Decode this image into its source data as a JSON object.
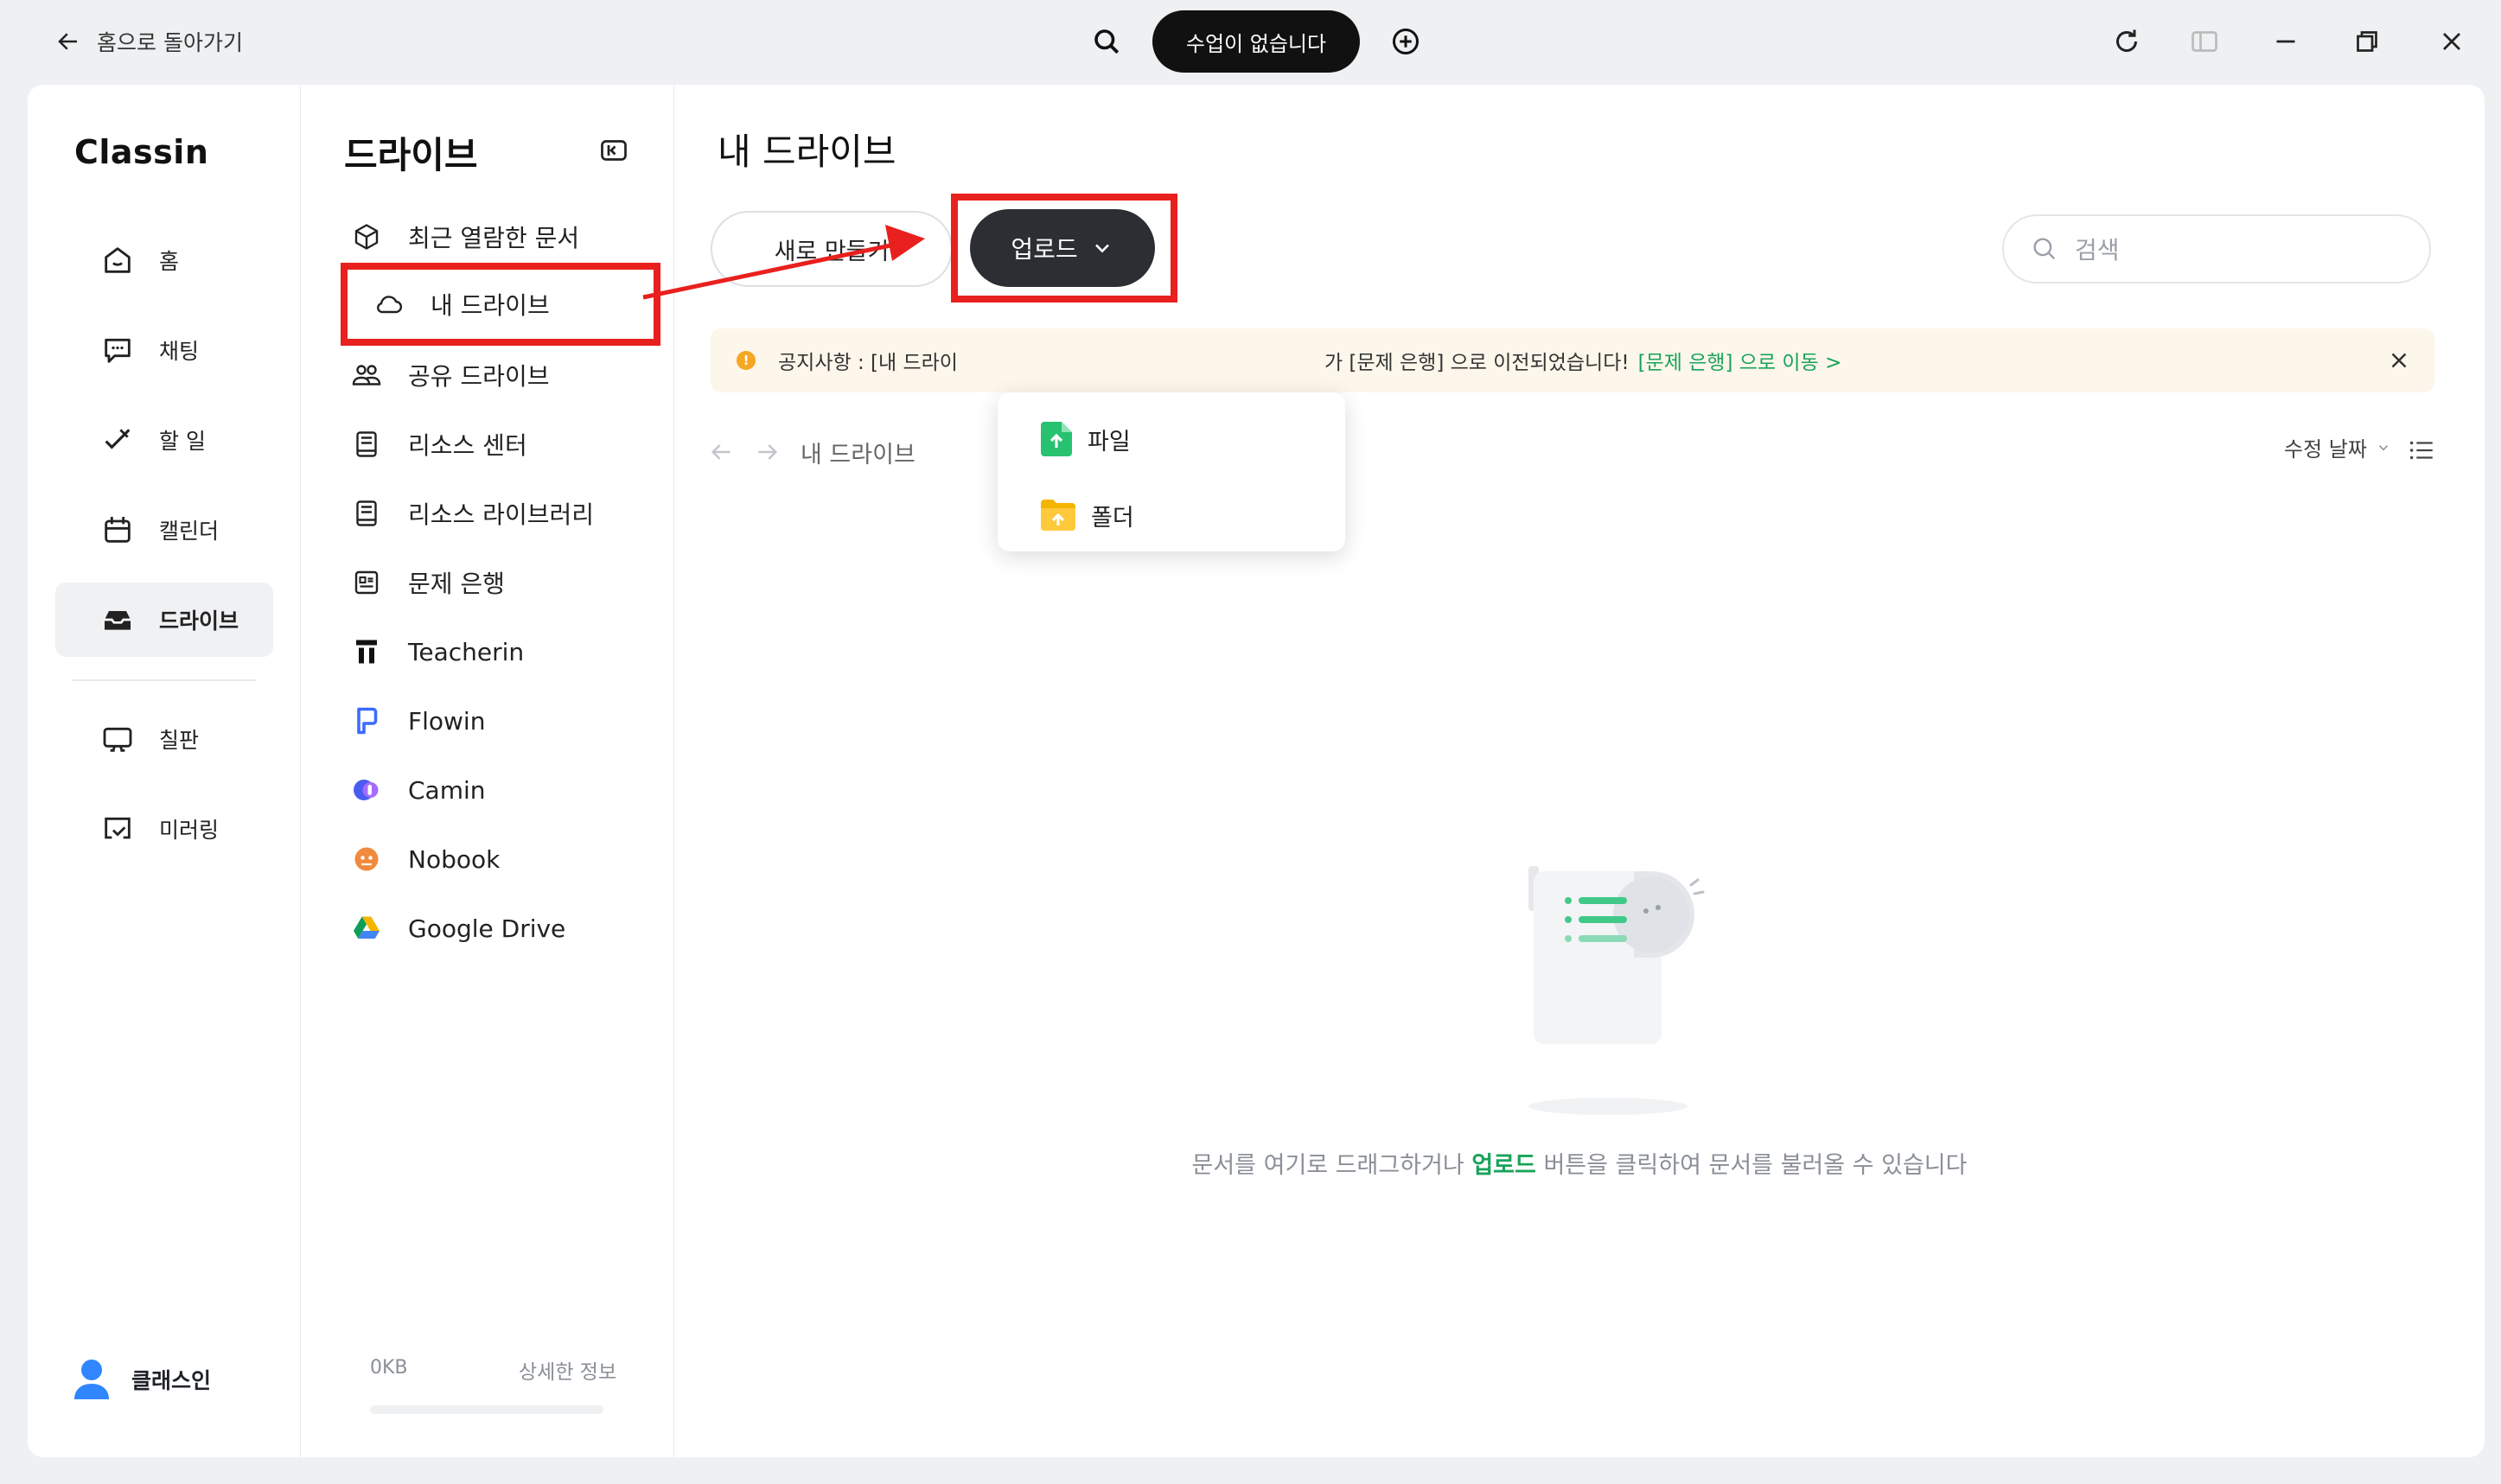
{
  "titlebar": {
    "back_label": "홈으로 돌아가기",
    "class_status": "수업이 없습니다"
  },
  "nav": {
    "logo": "Classin",
    "items": [
      {
        "label": "홈",
        "icon": "home-icon"
      },
      {
        "label": "채팅",
        "icon": "chat-icon"
      },
      {
        "label": "할 일",
        "icon": "todo-icon"
      },
      {
        "label": "캘린더",
        "icon": "calendar-icon"
      },
      {
        "label": "드라이브",
        "icon": "drive-icon",
        "active": true
      },
      {
        "label": "칠판",
        "icon": "blackboard-icon"
      },
      {
        "label": "미러링",
        "icon": "mirroring-icon"
      }
    ],
    "user_name": "클래스인"
  },
  "sidebar": {
    "title": "드라이브",
    "items": [
      {
        "label": "최근 열람한 문서",
        "icon": "cube-icon"
      },
      {
        "label": "내 드라이브",
        "icon": "cloud-icon",
        "highlighted": true
      },
      {
        "label": "공유 드라이브",
        "icon": "people-icon"
      },
      {
        "label": "리소스 센터",
        "icon": "book-icon"
      },
      {
        "label": "리소스 라이브러리",
        "icon": "library-icon"
      },
      {
        "label": "문제 은행",
        "icon": "question-bank-icon"
      },
      {
        "label": "Teacherin",
        "icon": "teacherin-icon"
      },
      {
        "label": "Flowin",
        "icon": "flowin-icon"
      },
      {
        "label": "Camin",
        "icon": "camin-icon"
      },
      {
        "label": "Nobook",
        "icon": "nobook-icon"
      },
      {
        "label": "Google Drive",
        "icon": "google-drive-icon"
      }
    ],
    "storage_used": "0KB",
    "storage_fraction": 0,
    "details_label": "상세한 정보"
  },
  "main": {
    "title": "내 드라이브",
    "new_button": "새로 만들기",
    "upload_button": "업로드",
    "search_placeholder": "검색",
    "notice_text": "공지사항 : [내 드라이",
    "notice_text_cont": "가 [문제 은행] 으로 이전되었습니다!",
    "notice_link": "[문제 은행] 으로 이동 >",
    "breadcrumb": "내 드라이브",
    "sort_label": "수정 날짜",
    "empty_prefix": "문서를 여기로 드래그하거나 ",
    "empty_highlight": "업로드",
    "empty_suffix": " 버튼을 클릭하여 문서를 불러올 수 있습니다"
  },
  "upload_menu": {
    "items": [
      {
        "label": "파일",
        "icon": "file-upload-icon"
      },
      {
        "label": "폴더",
        "icon": "folder-upload-icon"
      }
    ]
  },
  "colors": {
    "accent_green": "#19a35a",
    "annotation_red": "#e8201e",
    "upload_dark": "#2b2e33"
  }
}
